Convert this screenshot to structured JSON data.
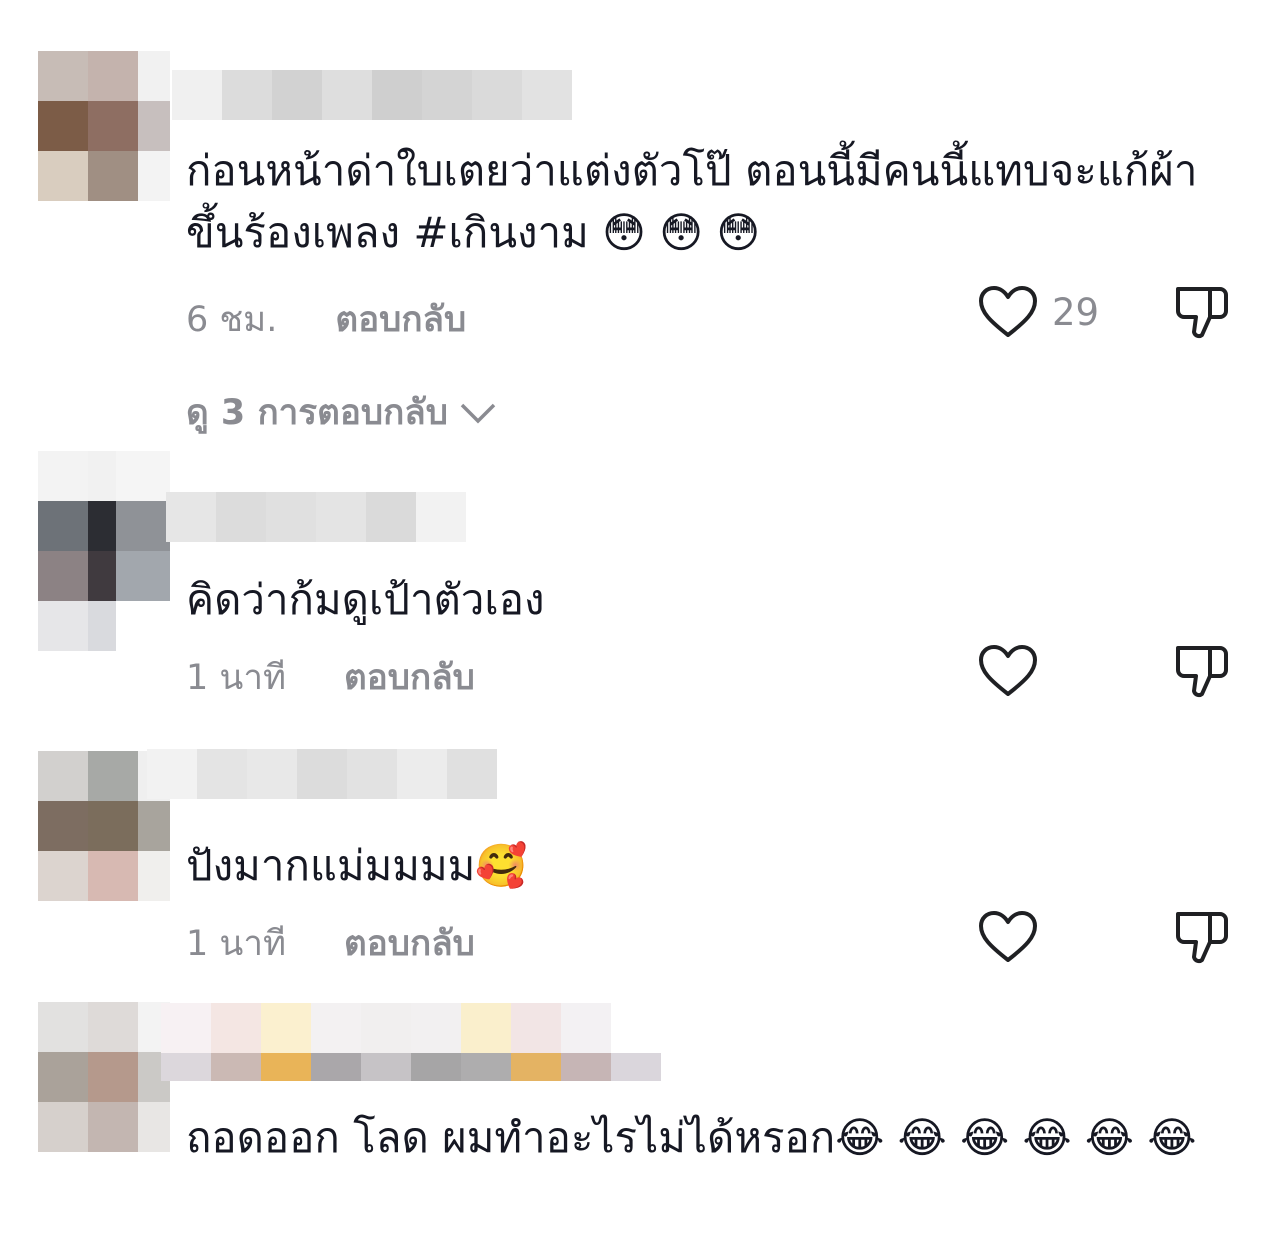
{
  "comments": [
    {
      "text": "ก่อนหน้าด่าใบเตยว่าแต่งตัวโป๊ ตอนนี้มีคนนี้แทบจะแก้ผ้าขึ้นร้องเพลง #เกินงาม 😳 😳 😳",
      "time": "6 ชม.",
      "reply_label": "ตอบกลับ",
      "likes": "29",
      "view_replies": "ดู 3 การตอบกลับ",
      "avatar_colors": [
        "#c7bcb6",
        "#c4b3ad",
        "#f1f1f1",
        "#7c5c47",
        "#8e6e62",
        "#c7bfbe",
        "#d9cdbf",
        "#a08f83",
        "#f3f3f3"
      ],
      "name_colors": [
        "#f0f0f0",
        "#dcdcdc",
        "#d2d2d2",
        "#dedede",
        "#cfcfcf",
        "#d4d4d4",
        "#dadada",
        "#e2e2e2"
      ]
    },
    {
      "text": "คิดว่าก้มดูเป้าตัวเอง",
      "time": "1 นาที",
      "reply_label": "ตอบกลับ",
      "avatar_colors": [
        "#f3f3f3",
        "#f1f1f1",
        "#f5f5f5",
        "#6d7278",
        "#2c2d33",
        "#8f9297",
        "#8c8284",
        "#403a3f",
        "#a2a7ad",
        "#e6e6e8",
        "#d9dade",
        "#ffffff"
      ],
      "name_colors": [
        "#e6e6e6",
        "#dcdcdc",
        "#e0e0e0",
        "#e4e4e4",
        "#dadada",
        "#f2f2f2"
      ]
    },
    {
      "text": "ปังมากแม่มมมม🥰",
      "time": "1 นาที",
      "reply_label": "ตอบกลับ",
      "avatar_colors": [
        "#d2d0ce",
        "#a7a9a6",
        "#efefef",
        "#7d6d61",
        "#7b6d5c",
        "#a8a49d",
        "#dcd4cf",
        "#d7b9b2",
        "#f0efed"
      ],
      "name_colors": [
        "#f2f2f2",
        "#e4e4e4",
        "#e8e8e8",
        "#dcdcdc",
        "#e2e2e2",
        "#ececec",
        "#e0e0e0"
      ]
    },
    {
      "text": "ถอดออก โลด ผมทำอะไรไม่ได้หรอก😂 😂 😂 😂 😂 😂",
      "avatar_colors": [
        "#e2e1e0",
        "#dedad8",
        "#f3f3f3",
        "#aaa29a",
        "#b5998c",
        "#cbc9c6",
        "#d6d0cc",
        "#c3b6b1",
        "#e8e6e4"
      ],
      "name_colors": [
        "#f7f1f3",
        "#f4e6e3",
        "#fbf0cf",
        "#f3f1f2",
        "#f1efef",
        "#f2f0f1",
        "#faefcc",
        "#f2e5e5",
        "#f3f1f3"
      ],
      "name_colors_row2": [
        "#dcd7dc",
        "#cbb9b4",
        "#e9b458",
        "#aaa7aa",
        "#c6c3c6",
        "#a6a5a6",
        "#aeadae",
        "#e4b363",
        "#c6b5b5",
        "#dad6dc"
      ]
    }
  ]
}
